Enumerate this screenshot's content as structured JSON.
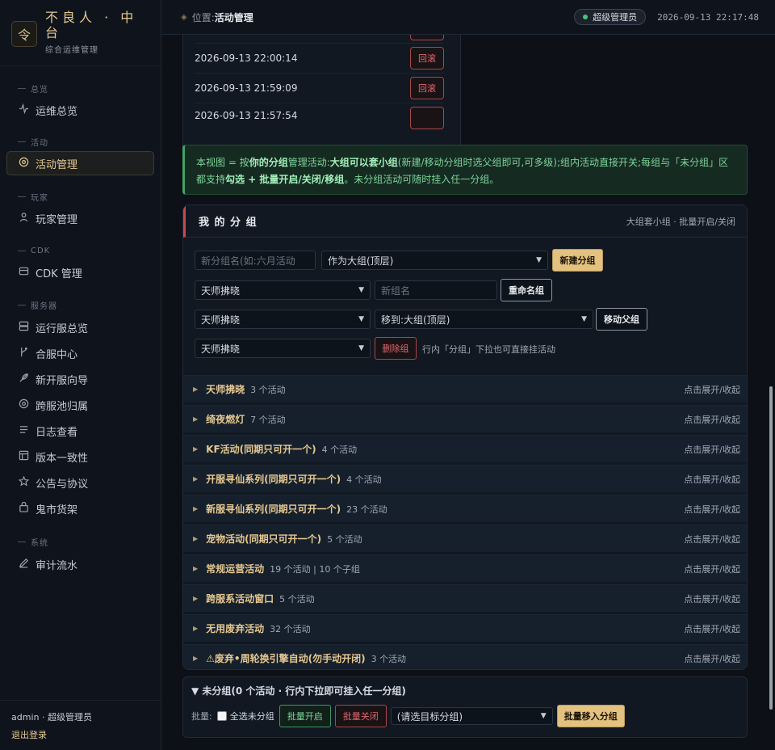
{
  "brand": {
    "logo": "令",
    "title": "不良人 · 中台",
    "subtitle": "综合运维管理"
  },
  "nav": {
    "sections": {
      "overview": "总览",
      "activity": "活动",
      "player": "玩家",
      "cdk": "CDK",
      "server": "服务器",
      "system": "系统"
    },
    "items": {
      "ops_overview": {
        "label": "运维总览",
        "icon": "pulse-icon"
      },
      "activity_mgmt": {
        "label": "活动管理",
        "icon": "target-icon"
      },
      "player_mgmt": {
        "label": "玩家管理",
        "icon": "user-icon"
      },
      "cdk_mgmt": {
        "label": "CDK 管理",
        "icon": "card-icon"
      },
      "running_servers": {
        "label": "运行服总览",
        "icon": "server-icon"
      },
      "merge_center": {
        "label": "合服中心",
        "icon": "merge-icon"
      },
      "new_server_wizard": {
        "label": "新开服向导",
        "icon": "feather-icon"
      },
      "cross_server_pool": {
        "label": "跨服池归属",
        "icon": "circle-icon"
      },
      "log_viewer": {
        "label": "日志查看",
        "icon": "list-icon"
      },
      "version_consistency": {
        "label": "版本一致性",
        "icon": "layout-icon"
      },
      "announcements": {
        "label": "公告与协议",
        "icon": "star-icon"
      },
      "black_market": {
        "label": "鬼市货架",
        "icon": "box-icon"
      },
      "audit_log": {
        "label": "审计流水",
        "icon": "pen-icon"
      }
    },
    "active": "activity_mgmt"
  },
  "footer": {
    "user": "admin · 超级管理员",
    "logout": "退出登录"
  },
  "header": {
    "crumb_label": "位置:",
    "crumb_page": "活动管理",
    "role": "超级管理员",
    "datetime": "2026-09-13 22:17:48"
  },
  "history": {
    "rows": [
      {
        "time": "",
        "action": ""
      },
      {
        "time": "2026-09-13 22:00:14",
        "action": "回滚"
      },
      {
        "time": "2026-09-13 21:59:09",
        "action": "回滚"
      },
      {
        "time": "2026-09-13 21:57:54",
        "action": ""
      }
    ]
  },
  "info": {
    "p1": "本视图 = 按",
    "b1": "你的分组",
    "p2": "管理活动:",
    "b2": "大组可以套小组",
    "p3": "(新建/移动分组时选父组即可,可多级);组内活动直接开关;每组与「未分组」区都支持",
    "b3": "勾选 + 批量开启/关闭/移组",
    "p4": "。未分组活动可随时挂入任一分组。"
  },
  "groups_card": {
    "title": "我 的 分 组",
    "hint": "大组套小组 · 批量开启/关闭",
    "new_group_placeholder": "新分组名(如:六月活动",
    "parent_select": "作为大组(顶层)",
    "new_group_btn": "新建分组",
    "rename_select": "天师拂晓",
    "rename_placeholder": "新组名",
    "rename_btn": "重命名组",
    "move_select": "天师拂晓",
    "move_target": "移到:大组(顶层)",
    "move_btn": "移动父组",
    "delete_select": "天师拂晓",
    "delete_btn": "删除组",
    "delete_note": "行内「分组」下拉也可直接挂活动",
    "toggle_label": "点击展开/收起",
    "items": [
      {
        "name": "天师拂晓",
        "meta": "3 个活动"
      },
      {
        "name": "绮夜燃灯",
        "meta": "7 个活动"
      },
      {
        "name": "KF活动(同期只可开一个)",
        "meta": "4 个活动"
      },
      {
        "name": "开服寻仙系列(同期只可开一个)",
        "meta": "4 个活动"
      },
      {
        "name": "新服寻仙系列(同期只可开一个)",
        "meta": "23 个活动"
      },
      {
        "name": "宠物活动(同期只可开一个)",
        "meta": "5 个活动"
      },
      {
        "name": "常规运营活动",
        "meta": "19 个活动 | 10 个子组"
      },
      {
        "name": "跨服系活动窗口",
        "meta": "5 个活动"
      },
      {
        "name": "无用废弃活动",
        "meta": "32 个活动"
      },
      {
        "name": "⚠废弃•周轮换引擎自动(勿手动开闭)",
        "meta": "3 个活动"
      }
    ]
  },
  "ungrouped": {
    "title": "▼ 未分组(0 个活动 · 行内下拉即可挂入任一分组)",
    "batch_label": "批量:",
    "select_all": "全选未分组",
    "enable_btn": "批量开启",
    "disable_btn": "批量关闭",
    "target_select": "(请选目标分组)",
    "move_btn": "批量移入分组"
  },
  "colors": {
    "accent": "#e6c890",
    "danger": "#e0676c",
    "success": "#7ed49a",
    "background": "#0d1117"
  }
}
